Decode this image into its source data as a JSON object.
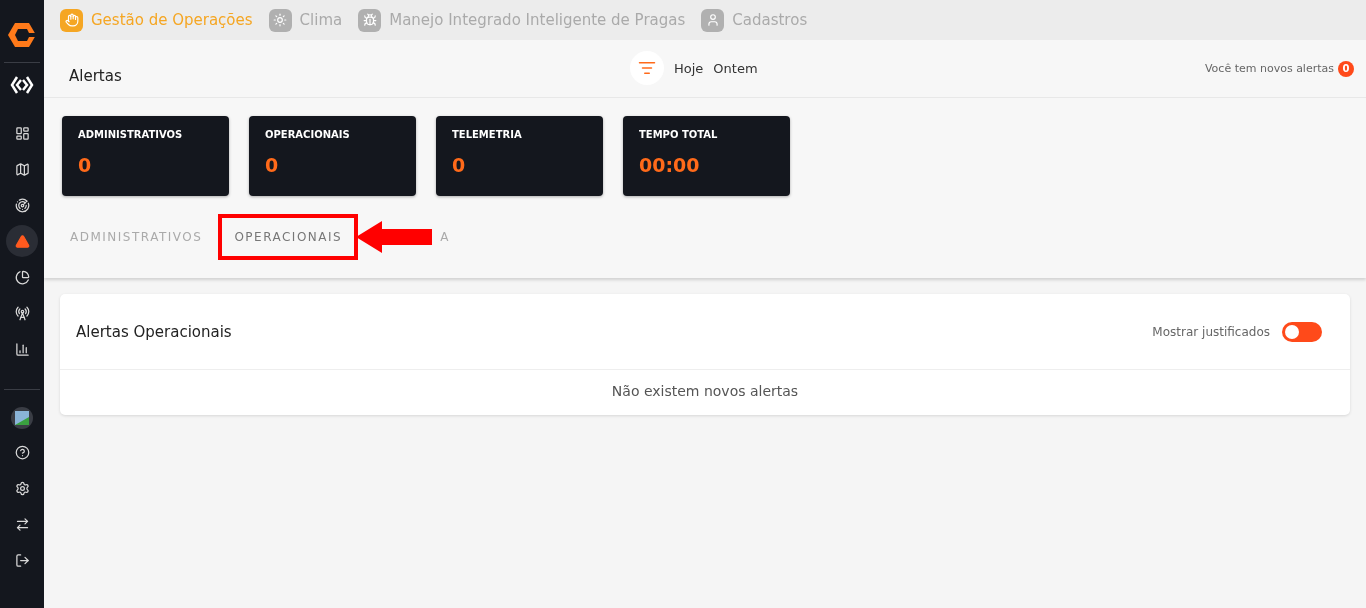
{
  "sidebar": {
    "items": [
      {
        "selected": false
      },
      {
        "selected": false
      },
      {
        "selected": false
      },
      {
        "selected": true
      },
      {
        "selected": false
      },
      {
        "selected": false
      },
      {
        "selected": false
      }
    ]
  },
  "top_nav": [
    {
      "label": "Gestão de Operações",
      "selected": true
    },
    {
      "label": "Clima",
      "selected": false
    },
    {
      "label": "Manejo Integrado Inteligente de Pragas",
      "selected": false
    },
    {
      "label": "Cadastros",
      "selected": false
    }
  ],
  "header": {
    "title": "Alertas",
    "filters": [
      "Hoje",
      "Ontem"
    ],
    "notice": "Você tem novos alertas",
    "notice_count": "0"
  },
  "stat_cards": [
    {
      "label": "ADMINISTRATIVOS",
      "value": "0"
    },
    {
      "label": "OPERACIONAIS",
      "value": "0"
    },
    {
      "label": "TELEMETRIA",
      "value": "0"
    },
    {
      "label": "TEMPO TOTAL",
      "value": "00:00"
    }
  ],
  "tabs": [
    {
      "label": "ADMINISTRATIVOS",
      "selected": false
    },
    {
      "label": "OPERACIONAIS",
      "selected": true
    },
    {
      "label": "A",
      "selected": false
    }
  ],
  "panel": {
    "title": "Alertas Operacionais",
    "toggle": {
      "label": "Mostrar justificados",
      "on": false
    },
    "empty_message": "Não existem novos alertas"
  }
}
